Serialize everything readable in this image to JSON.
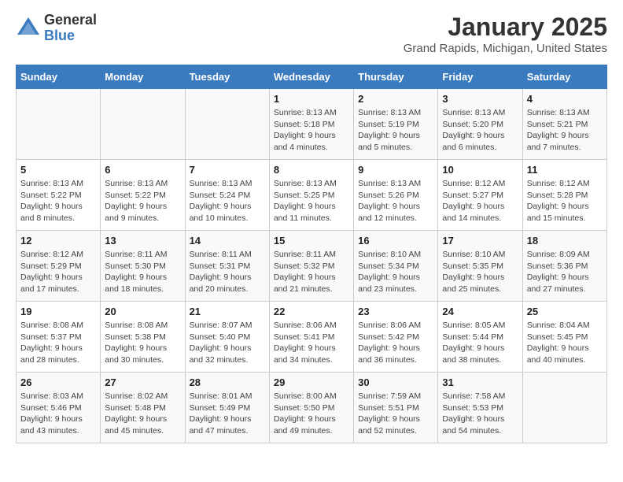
{
  "logo": {
    "general": "General",
    "blue": "Blue"
  },
  "title": "January 2025",
  "location": "Grand Rapids, Michigan, United States",
  "days_header": [
    "Sunday",
    "Monday",
    "Tuesday",
    "Wednesday",
    "Thursday",
    "Friday",
    "Saturday"
  ],
  "weeks": [
    [
      {
        "day": "",
        "info": ""
      },
      {
        "day": "",
        "info": ""
      },
      {
        "day": "",
        "info": ""
      },
      {
        "day": "1",
        "info": "Sunrise: 8:13 AM\nSunset: 5:18 PM\nDaylight: 9 hours\nand 4 minutes."
      },
      {
        "day": "2",
        "info": "Sunrise: 8:13 AM\nSunset: 5:19 PM\nDaylight: 9 hours\nand 5 minutes."
      },
      {
        "day": "3",
        "info": "Sunrise: 8:13 AM\nSunset: 5:20 PM\nDaylight: 9 hours\nand 6 minutes."
      },
      {
        "day": "4",
        "info": "Sunrise: 8:13 AM\nSunset: 5:21 PM\nDaylight: 9 hours\nand 7 minutes."
      }
    ],
    [
      {
        "day": "5",
        "info": "Sunrise: 8:13 AM\nSunset: 5:22 PM\nDaylight: 9 hours\nand 8 minutes."
      },
      {
        "day": "6",
        "info": "Sunrise: 8:13 AM\nSunset: 5:22 PM\nDaylight: 9 hours\nand 9 minutes."
      },
      {
        "day": "7",
        "info": "Sunrise: 8:13 AM\nSunset: 5:24 PM\nDaylight: 9 hours\nand 10 minutes."
      },
      {
        "day": "8",
        "info": "Sunrise: 8:13 AM\nSunset: 5:25 PM\nDaylight: 9 hours\nand 11 minutes."
      },
      {
        "day": "9",
        "info": "Sunrise: 8:13 AM\nSunset: 5:26 PM\nDaylight: 9 hours\nand 12 minutes."
      },
      {
        "day": "10",
        "info": "Sunrise: 8:12 AM\nSunset: 5:27 PM\nDaylight: 9 hours\nand 14 minutes."
      },
      {
        "day": "11",
        "info": "Sunrise: 8:12 AM\nSunset: 5:28 PM\nDaylight: 9 hours\nand 15 minutes."
      }
    ],
    [
      {
        "day": "12",
        "info": "Sunrise: 8:12 AM\nSunset: 5:29 PM\nDaylight: 9 hours\nand 17 minutes."
      },
      {
        "day": "13",
        "info": "Sunrise: 8:11 AM\nSunset: 5:30 PM\nDaylight: 9 hours\nand 18 minutes."
      },
      {
        "day": "14",
        "info": "Sunrise: 8:11 AM\nSunset: 5:31 PM\nDaylight: 9 hours\nand 20 minutes."
      },
      {
        "day": "15",
        "info": "Sunrise: 8:11 AM\nSunset: 5:32 PM\nDaylight: 9 hours\nand 21 minutes."
      },
      {
        "day": "16",
        "info": "Sunrise: 8:10 AM\nSunset: 5:34 PM\nDaylight: 9 hours\nand 23 minutes."
      },
      {
        "day": "17",
        "info": "Sunrise: 8:10 AM\nSunset: 5:35 PM\nDaylight: 9 hours\nand 25 minutes."
      },
      {
        "day": "18",
        "info": "Sunrise: 8:09 AM\nSunset: 5:36 PM\nDaylight: 9 hours\nand 27 minutes."
      }
    ],
    [
      {
        "day": "19",
        "info": "Sunrise: 8:08 AM\nSunset: 5:37 PM\nDaylight: 9 hours\nand 28 minutes."
      },
      {
        "day": "20",
        "info": "Sunrise: 8:08 AM\nSunset: 5:38 PM\nDaylight: 9 hours\nand 30 minutes."
      },
      {
        "day": "21",
        "info": "Sunrise: 8:07 AM\nSunset: 5:40 PM\nDaylight: 9 hours\nand 32 minutes."
      },
      {
        "day": "22",
        "info": "Sunrise: 8:06 AM\nSunset: 5:41 PM\nDaylight: 9 hours\nand 34 minutes."
      },
      {
        "day": "23",
        "info": "Sunrise: 8:06 AM\nSunset: 5:42 PM\nDaylight: 9 hours\nand 36 minutes."
      },
      {
        "day": "24",
        "info": "Sunrise: 8:05 AM\nSunset: 5:44 PM\nDaylight: 9 hours\nand 38 minutes."
      },
      {
        "day": "25",
        "info": "Sunrise: 8:04 AM\nSunset: 5:45 PM\nDaylight: 9 hours\nand 40 minutes."
      }
    ],
    [
      {
        "day": "26",
        "info": "Sunrise: 8:03 AM\nSunset: 5:46 PM\nDaylight: 9 hours\nand 43 minutes."
      },
      {
        "day": "27",
        "info": "Sunrise: 8:02 AM\nSunset: 5:48 PM\nDaylight: 9 hours\nand 45 minutes."
      },
      {
        "day": "28",
        "info": "Sunrise: 8:01 AM\nSunset: 5:49 PM\nDaylight: 9 hours\nand 47 minutes."
      },
      {
        "day": "29",
        "info": "Sunrise: 8:00 AM\nSunset: 5:50 PM\nDaylight: 9 hours\nand 49 minutes."
      },
      {
        "day": "30",
        "info": "Sunrise: 7:59 AM\nSunset: 5:51 PM\nDaylight: 9 hours\nand 52 minutes."
      },
      {
        "day": "31",
        "info": "Sunrise: 7:58 AM\nSunset: 5:53 PM\nDaylight: 9 hours\nand 54 minutes."
      },
      {
        "day": "",
        "info": ""
      }
    ]
  ]
}
